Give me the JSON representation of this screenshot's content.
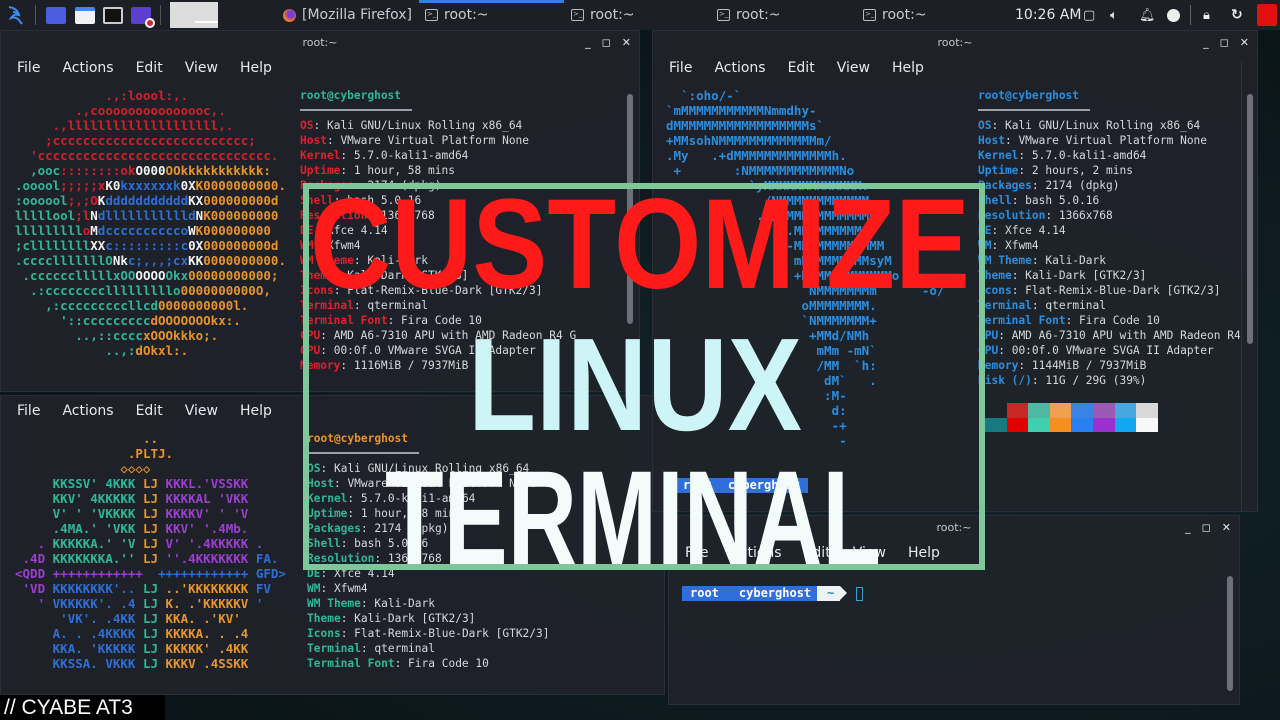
{
  "colors": {
    "r": "#d3202c",
    "t": "#2fb79a",
    "w": "#f2f2f2",
    "b": "#2d6fd6",
    "o": "#e8942a",
    "p": "#9b3fd0",
    "c": "#2a8fe0",
    "accent": "#2f80ed",
    "frame": "#7ec79b"
  },
  "panel": {
    "launcher_icons": [
      "kali-menu-icon",
      "workspace-blue-icon",
      "file-manager-icon",
      "terminal-icon",
      "screen-recorder-icon"
    ],
    "tasks": [
      {
        "icon": "firefox-icon",
        "label": "[Mozilla Firefox]"
      },
      {
        "icon": "terminal-icon",
        "label": "root:~",
        "active": true
      },
      {
        "icon": "terminal-icon",
        "label": "root:~"
      },
      {
        "icon": "terminal-icon",
        "label": "root:~"
      },
      {
        "icon": "terminal-icon",
        "label": "root:~"
      }
    ],
    "clock": "10:26 AM",
    "tray_icons": [
      "display-icon",
      "volume-icon",
      "bell-icon",
      "update-icon",
      "lock-icon",
      "refresh-icon",
      "power-icon"
    ]
  },
  "menu": [
    "File",
    "Actions",
    "Edit",
    "View",
    "Help"
  ],
  "windows": {
    "top_left": {
      "title": "root:~",
      "header": "root@cyberghost",
      "ascii": [
        [
          "            ",
          [
            ".,:loool:,.",
            "r"
          ]
        ],
        [
          "        ",
          [
            ".,cooooooooooooooc,.",
            "r"
          ]
        ],
        [
          "     ",
          [
            ".,llllllllllllllllllll,.",
            "r"
          ]
        ],
        [
          "    ",
          [
            ";cccccccccccccccccccccccccc;",
            "r"
          ]
        ],
        [
          "  ",
          [
            "'ccccccccccccccccccccccccccccccc.",
            "r"
          ]
        ],
        [
          "  ",
          [
            ",ooc",
            "t"
          ],
          [
            "::::::::ok",
            "r"
          ],
          [
            "O000",
            "w"
          ],
          [
            "OOkkkkkkkkkkk:",
            "o"
          ]
        ],
        [
          "",
          [
            ".ooool",
            "t"
          ],
          [
            ";;;;;x",
            "r"
          ],
          [
            "K0",
            "w"
          ],
          [
            "kxxxxxxk",
            "b"
          ],
          [
            "0X",
            "w"
          ],
          [
            "K0000000000.",
            "o"
          ]
        ],
        [
          "",
          [
            ":oooool",
            "t"
          ],
          [
            ";,;O",
            "r"
          ],
          [
            "K",
            "w"
          ],
          [
            "ddddddddddd",
            "b"
          ],
          [
            "KX",
            "w"
          ],
          [
            "000000000d",
            "o"
          ]
        ],
        [
          "",
          [
            "lllllool",
            "t"
          ],
          [
            ";l",
            "r"
          ],
          [
            "N",
            "w"
          ],
          [
            "dllllllllllld",
            "b"
          ],
          [
            "N",
            "w"
          ],
          [
            "K000000000",
            "o"
          ]
        ],
        [
          "",
          [
            "lllllllll",
            "t"
          ],
          [
            "o",
            "r"
          ],
          [
            "M",
            "w"
          ],
          [
            "dcccccccccco",
            "b"
          ],
          [
            "W",
            "w"
          ],
          [
            "K000000000",
            "o"
          ]
        ],
        [
          "",
          [
            ";cllllllll",
            "t"
          ],
          [
            "XX",
            "w"
          ],
          [
            "c:::::::::c",
            "b"
          ],
          [
            "0X",
            "w"
          ],
          [
            "000000000d",
            "o"
          ]
        ],
        [
          "",
          [
            ".cccclllllllO",
            "t"
          ],
          [
            "Nk",
            "w"
          ],
          [
            "c;,,,;cx",
            "b"
          ],
          [
            "KK",
            "w"
          ],
          [
            "0000000000.",
            "o"
          ]
        ],
        [
          " ",
          [
            ".cccccclllllxOO",
            "t"
          ],
          [
            "OOOO",
            "w"
          ],
          [
            "Okx",
            "t"
          ],
          [
            "00000000000;",
            "o"
          ]
        ],
        [
          "  ",
          [
            ".:cccccccclllllllllo",
            "t"
          ],
          [
            "0000000000O,",
            "o"
          ]
        ],
        [
          "    ",
          [
            ",:cccccccccllcd",
            "t"
          ],
          [
            "0000000000l.",
            "o"
          ]
        ],
        [
          "      ",
          [
            "'::ccccccccc",
            "t"
          ],
          [
            "dOOOOOOOkx:.",
            "o"
          ]
        ],
        [
          "        ",
          [
            "..,::cccc",
            "t"
          ],
          [
            "xOOOkkko;.",
            "o"
          ]
        ],
        [
          "            ",
          [
            "..,:",
            "t"
          ],
          [
            "dOkxl:.",
            "o"
          ]
        ]
      ],
      "info": [
        [
          "OS",
          "Kali GNU/Linux Rolling x86_64"
        ],
        [
          "Host",
          "VMware Virtual Platform None"
        ],
        [
          "Kernel",
          "5.7.0-kali1-amd64"
        ],
        [
          "Uptime",
          "1 hour, 58 mins"
        ],
        [
          "Packages",
          "2174 (dpkg)"
        ],
        [
          "Shell",
          "bash 5.0.16"
        ],
        [
          "Resolution",
          "1366x768"
        ],
        [
          "DE",
          "Xfce 4.14"
        ],
        [
          "WM",
          "Xfwm4"
        ],
        [
          "WM Theme",
          "Kali-Dark"
        ],
        [
          "Theme",
          "Kali-Dark [GTK2/3]"
        ],
        [
          "Icons",
          "Flat-Remix-Blue-Dark [GTK2/3]"
        ],
        [
          "Terminal",
          "qterminal"
        ],
        [
          "Terminal Font",
          "Fira Code 10"
        ],
        [
          "CPU",
          "AMD A6-7310 APU with AMD Radeon R4 G"
        ],
        [
          "GPU",
          "00:0f.0 VMware SVGA II Adapter"
        ],
        [
          "Memory",
          "1116MiB / 7937MiB"
        ]
      ]
    },
    "top_right": {
      "title": "root:~",
      "header": "root@cyberghost",
      "ascii": [
        [
          "  ",
          [
            "`:oho/-`",
            "c"
          ]
        ],
        [
          "",
          [
            "`mMMMMMMMMMMMNmmdhy-",
            "c"
          ]
        ],
        [
          "",
          [
            "dMMMMMMMMMMMMMMMMMMs`",
            "c"
          ]
        ],
        [
          "",
          [
            "+MMsohNMMMMMMMMMMMMMm/",
            "c"
          ]
        ],
        [
          "",
          [
            ".My   .+dMMMMMMMMMMMMMh.",
            "c"
          ]
        ],
        [
          "",
          [
            " +       :NMMMMMMMMMMMMNo",
            "c"
          ]
        ],
        [
          "",
          [
            "           `yMMMMMMMMMMMMM:",
            "c"
          ]
        ],
        [
          "",
          [
            "             /NMMMMMMMMMMMM",
            "c"
          ]
        ],
        [
          "",
          [
            "            .`/MMMMMMMMMMMMM",
            "c"
          ]
        ],
        [
          "",
          [
            "              ` .MMMMMMMMMd-",
            "c"
          ]
        ],
        [
          "",
          [
            "                -MMMMMMMMMMMM",
            "c"
          ]
        ],
        [
          "",
          [
            "                 mMMMMMMMMMsyM",
            "c"
          ]
        ],
        [
          "",
          [
            "                 +MMMMMMMMMMMMo",
            "c"
          ]
        ],
        [
          "",
          [
            "                  `NMMMMMMMm      -o/",
            "c"
          ]
        ],
        [
          "",
          [
            "                  oMMMMMMMM.",
            "c"
          ]
        ],
        [
          "",
          [
            "                  `NMMMMMMM+",
            "c"
          ]
        ],
        [
          "",
          [
            "                   +MMd/NMh",
            "c"
          ]
        ],
        [
          "",
          [
            "                    mMm -mN`",
            "c"
          ]
        ],
        [
          "",
          [
            "                    /MM  `h:",
            "c"
          ]
        ],
        [
          "",
          [
            "                     dM`   .",
            "c"
          ]
        ],
        [
          "",
          [
            "                     :M-",
            "c"
          ]
        ],
        [
          "",
          [
            "                      d:",
            "c"
          ]
        ],
        [
          "",
          [
            "                      -+",
            "c"
          ]
        ],
        [
          "",
          [
            "                       -",
            "c"
          ]
        ]
      ],
      "info": [
        [
          "OS",
          "Kali GNU/Linux Rolling x86_64"
        ],
        [
          "Host",
          "VMware Virtual Platform None"
        ],
        [
          "Kernel",
          "5.7.0-kali1-amd64"
        ],
        [
          "Uptime",
          "2 hours, 2 mins"
        ],
        [
          "Packages",
          "2174 (dpkg)"
        ],
        [
          "Shell",
          "bash 5.0.16"
        ],
        [
          "Resolution",
          "1366x768"
        ],
        [
          "DE",
          "Xfce 4.14"
        ],
        [
          "WM",
          "Xfwm4"
        ],
        [
          "WM Theme",
          "Kali-Dark"
        ],
        [
          "Theme",
          "Kali-Dark [GTK2/3]"
        ],
        [
          "Icons",
          "Flat-Remix-Blue-Dark [GTK2/3]"
        ],
        [
          "Terminal",
          "qterminal"
        ],
        [
          "Terminal Font",
          "Fira Code 10"
        ],
        [
          "CPU",
          "AMD A6-7310 APU with AMD Radeon R4 G"
        ],
        [
          "GPU",
          "00:0f.0 VMware SVGA II Adapter"
        ],
        [
          "Memory",
          "1144MiB / 7937MiB"
        ],
        [
          "Disk (/)",
          "11G / 29G (39%)"
        ]
      ],
      "palette_top": [
        "#1d2128",
        "#c62828",
        "#4fb8a0",
        "#f0a050",
        "#3b82e6",
        "#9b59b6",
        "#47a8e0",
        "#d8d8d8"
      ],
      "palette_bottom": [
        "#167a80",
        "#e00000",
        "#3fd0b0",
        "#f59020",
        "#2a7ff0",
        "#9a30d0",
        "#10a8f0",
        "#f8f8f8"
      ],
      "prompt": [
        "root",
        "cyberghost"
      ]
    },
    "bottom_left": {
      "ascii": [
        [
          "                 ",
          [
            "..",
            "o"
          ]
        ],
        [
          "               ",
          [
            ".PLTJ.",
            "o"
          ]
        ],
        [
          "              ",
          [
            "◇◇◇◇",
            "o"
          ]
        ],
        [
          "     ",
          [
            "KKSSV' 4KKK",
            "t"
          ],
          [
            " LJ ",
            "o"
          ],
          [
            "KKKL.'VSSKK",
            "p"
          ]
        ],
        [
          "     ",
          [
            "KKV' 4KKKKK",
            "t"
          ],
          [
            " LJ ",
            "o"
          ],
          [
            "KKKKAL 'VKK",
            "p"
          ]
        ],
        [
          "     ",
          [
            "V' ' 'VKKKK",
            "t"
          ],
          [
            " LJ ",
            "o"
          ],
          [
            "KKKKV' ' 'V",
            "p"
          ]
        ],
        [
          "     ",
          [
            ".4MA.' 'VKK",
            "t"
          ],
          [
            " LJ ",
            "o"
          ],
          [
            "KKV' '.4Mb.",
            "p"
          ]
        ],
        [
          "   ",
          [
            ". ",
            "p"
          ],
          [
            "KKKKKA.' 'V",
            "t"
          ],
          [
            " LJ ",
            "o"
          ],
          [
            "V' '.4KKKKK",
            "p"
          ],
          [
            " .",
            "b"
          ]
        ],
        [
          " ",
          [
            ".4D ",
            "p"
          ],
          [
            "KKKKKKKA.''",
            "t"
          ],
          [
            " LJ ",
            "o"
          ],
          [
            "''.4KKKKKKK",
            "p"
          ],
          [
            " FA.",
            "b"
          ]
        ],
        [
          "",
          [
            "<QDD ",
            "p"
          ],
          [
            "++++++++++++",
            "p"
          ],
          [
            "  ",
            ""
          ],
          [
            "++++++++++++",
            "b"
          ],
          [
            " GFD>",
            "b"
          ]
        ],
        [
          " ",
          [
            "'VD ",
            "p"
          ],
          [
            "KKKKKKKK'..",
            "b"
          ],
          [
            " LJ ",
            "t"
          ],
          [
            "..'KKKKKKKK",
            "o"
          ],
          [
            " FV",
            "b"
          ]
        ],
        [
          "   ",
          [
            "' ",
            "p"
          ],
          [
            "VKKKKK'. .4",
            "b"
          ],
          [
            " LJ ",
            "t"
          ],
          [
            "K. .'KKKKKV",
            "o"
          ],
          [
            " '",
            "b"
          ]
        ],
        [
          "      ",
          [
            "'VK'. .4KK",
            "b"
          ],
          [
            " LJ ",
            "t"
          ],
          [
            "KKA. .'KV'",
            "o"
          ]
        ],
        [
          "     ",
          [
            "A. . .4KKKK",
            "b"
          ],
          [
            " LJ ",
            "t"
          ],
          [
            "KKKKA. . .4",
            "o"
          ]
        ],
        [
          "     ",
          [
            "KKA. 'KKKKK",
            "b"
          ],
          [
            " LJ ",
            "t"
          ],
          [
            "KKKKK' .4KK",
            "o"
          ]
        ],
        [
          "     ",
          [
            "KKSSA. VKKK",
            "b"
          ],
          [
            " LJ ",
            "t"
          ],
          [
            "KKKV .4SSKK",
            "o"
          ]
        ]
      ],
      "header": "root@cyberghost",
      "info": [
        [
          "OS",
          "Kali GNU/Linux Rolling x86_64"
        ],
        [
          "Host",
          "VMware Virtual Platform None"
        ],
        [
          "Kernel",
          "5.7.0-kali1-amd64"
        ],
        [
          "Uptime",
          "1 hour, 58 mins"
        ],
        [
          "Packages",
          "2174 (dpkg)"
        ],
        [
          "Shell",
          "bash 5.0.16"
        ],
        [
          "Resolution",
          "1366x768"
        ],
        [
          "DE",
          "Xfce 4.14"
        ],
        [
          "WM",
          "Xfwm4"
        ],
        [
          "WM Theme",
          "Kali-Dark"
        ],
        [
          "Theme",
          "Kali-Dark [GTK2/3]"
        ],
        [
          "Icons",
          "Flat-Remix-Blue-Dark [GTK2/3]"
        ],
        [
          "Terminal",
          "qterminal"
        ],
        [
          "Terminal Font",
          "Fira Code 10"
        ]
      ]
    },
    "bottom_right": {
      "title": "root:~",
      "prompt": [
        "root",
        "cyberghost"
      ],
      "cwd": "~"
    }
  },
  "overlay": {
    "line1": "CUSTOMIZE",
    "line2": "LINUX",
    "line3": "TERMINAL"
  },
  "caption": "// CYABE AT3"
}
